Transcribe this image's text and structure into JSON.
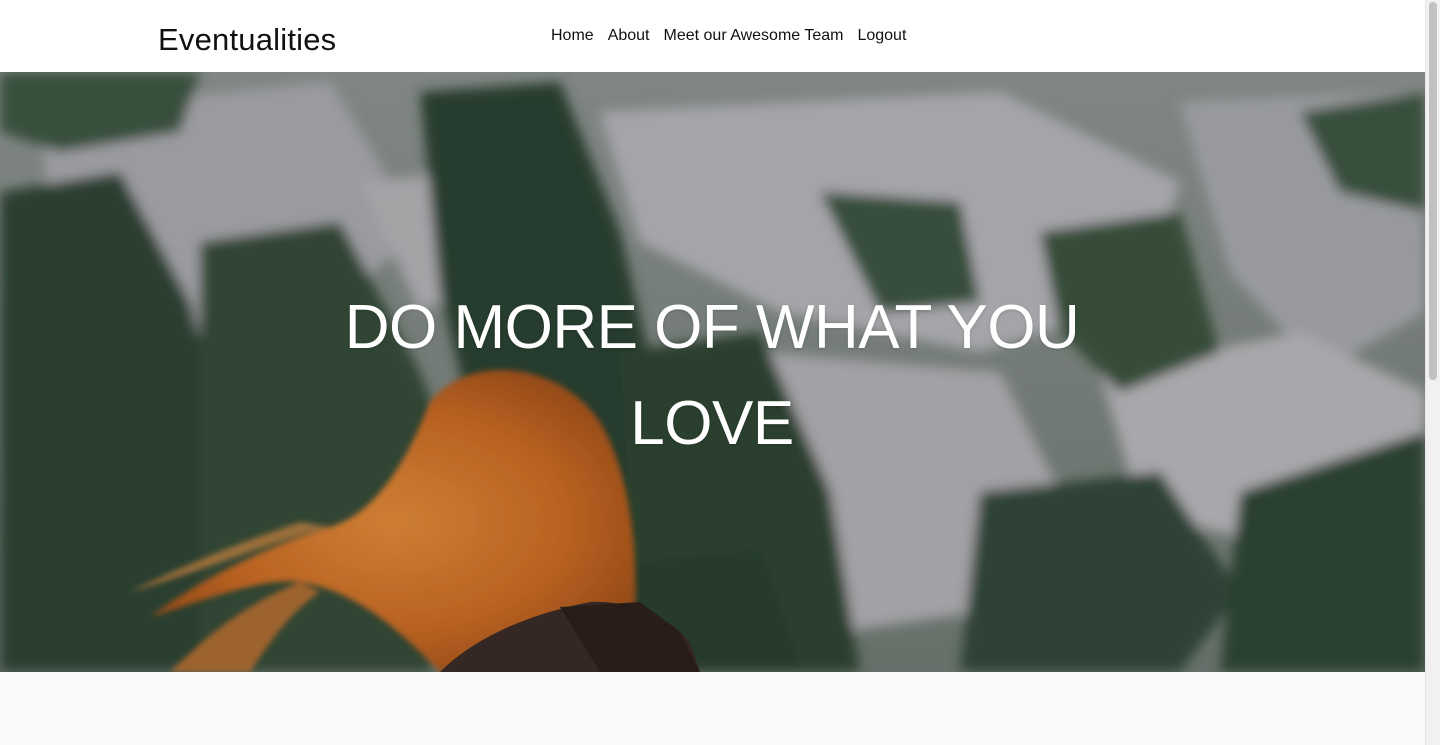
{
  "navbar": {
    "brand": "Eventualities",
    "links": [
      {
        "label": "Home"
      },
      {
        "label": "About"
      },
      {
        "label": "Meet our Awesome Team"
      },
      {
        "label": "Logout"
      }
    ]
  },
  "hero": {
    "title": "DO MORE OF WHAT YOU LOVE"
  }
}
